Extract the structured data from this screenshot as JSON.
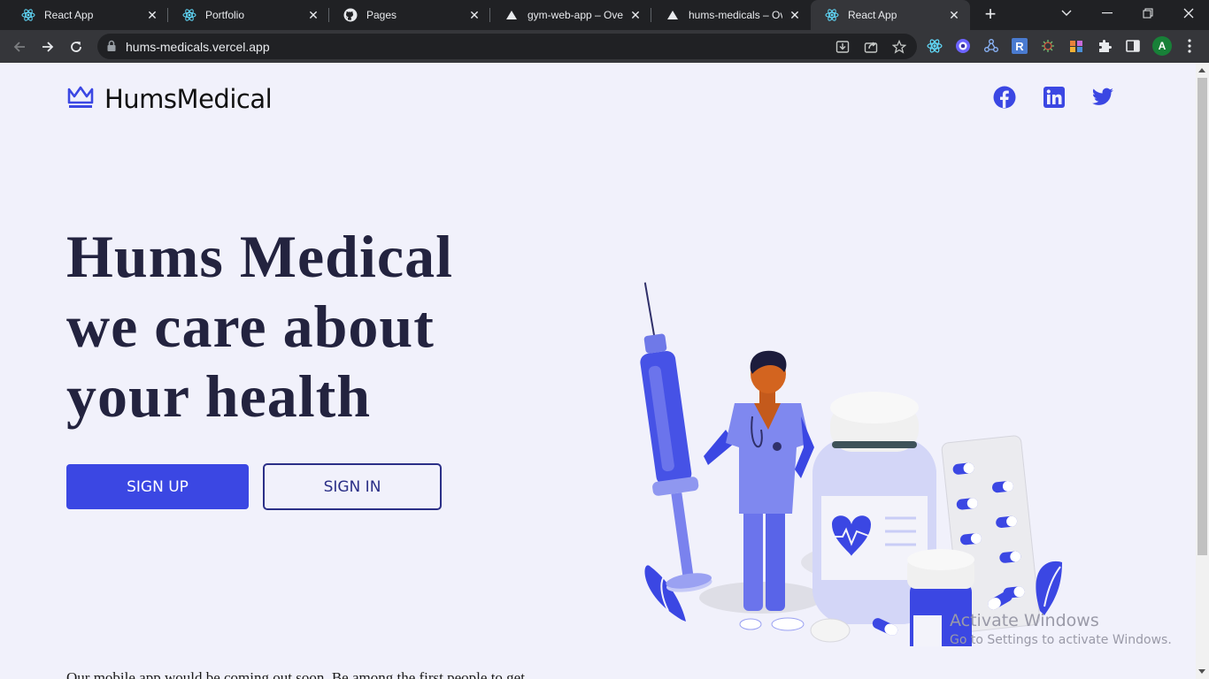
{
  "tabs": [
    {
      "title": "React App",
      "icon": "react-icon"
    },
    {
      "title": "Portfolio",
      "icon": "react-icon"
    },
    {
      "title": "Pages",
      "icon": "github-icon"
    },
    {
      "title": "gym-web-app – Overview",
      "icon": "vercel-icon"
    },
    {
      "title": "hums-medicals – Overview",
      "icon": "vercel-icon"
    },
    {
      "title": "React App",
      "icon": "react-icon",
      "active": true
    }
  ],
  "address_bar": {
    "url": "hums-medicals.vercel.app"
  },
  "profile": {
    "initial": "A",
    "color": "#188038"
  },
  "extensions": [
    {
      "icon": "react-devtools-icon"
    },
    {
      "icon": "extension-icon"
    },
    {
      "icon": "network-icon"
    },
    {
      "icon": "r-extension-icon",
      "label": "R"
    },
    {
      "icon": "bug-icon"
    },
    {
      "icon": "extension-icon"
    }
  ],
  "site": {
    "logo_text": "HumsMedical",
    "social": [
      {
        "name": "facebook"
      },
      {
        "name": "linkedin"
      },
      {
        "name": "twitter"
      }
    ],
    "hero": {
      "lines": [
        "Hums Medical",
        "we care about",
        "your health"
      ]
    },
    "buttons": {
      "signup": "SIGN UP",
      "signin": "SIGN IN"
    },
    "teaser": "Our mobile app would be coming out soon. Be among the first people to get"
  },
  "watermark": {
    "title": "Activate Windows",
    "subtitle": "Go to Settings to activate Windows."
  },
  "colors": {
    "accent": "#3b47e3",
    "heading": "#23233f",
    "page_bg": "#f1f1fb"
  }
}
